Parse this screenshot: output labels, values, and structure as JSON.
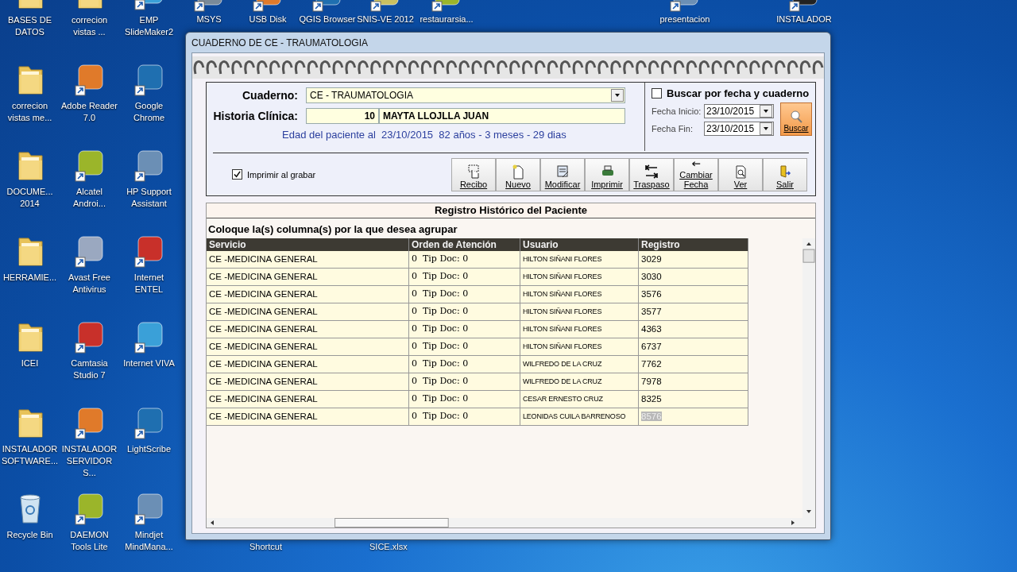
{
  "desktop": {
    "left_icons": [
      {
        "label": "BASES DE DATOS",
        "kind": "folder"
      },
      {
        "label": "correcion vistas ...",
        "kind": "folder"
      },
      {
        "label": "EMP SlideMaker2",
        "kind": "shortcut"
      },
      {
        "label": "correcion vistas me...",
        "kind": "folder"
      },
      {
        "label": "Adobe Reader 7.0",
        "kind": "shortcut"
      },
      {
        "label": "Google Chrome",
        "kind": "shortcut"
      },
      {
        "label": "DOCUME... 2014",
        "kind": "folder"
      },
      {
        "label": "Alcatel Androi...",
        "kind": "shortcut"
      },
      {
        "label": "HP Support Assistant",
        "kind": "shortcut"
      },
      {
        "label": "HERRAMIE...",
        "kind": "folder"
      },
      {
        "label": "Avast Free Antivirus",
        "kind": "shortcut"
      },
      {
        "label": "Internet ENTEL",
        "kind": "shortcut"
      },
      {
        "label": "ICEI",
        "kind": "folder"
      },
      {
        "label": "Camtasia Studio 7",
        "kind": "shortcut"
      },
      {
        "label": "Internet VIVA",
        "kind": "shortcut"
      },
      {
        "label": "INSTALADOR SOFTWARE...",
        "kind": "folder"
      },
      {
        "label": "INSTALADOR SERVIDOR S...",
        "kind": "shortcut"
      },
      {
        "label": "LightScribe",
        "kind": "shortcut"
      },
      {
        "label": "Recycle Bin",
        "kind": "bin"
      },
      {
        "label": "DAEMON Tools Lite",
        "kind": "shortcut"
      },
      {
        "label": "Mindjet MindMana...",
        "kind": "shortcut"
      }
    ],
    "top_icons": [
      {
        "label": "MSYS"
      },
      {
        "label": "USB Disk"
      },
      {
        "label": "QGIS Browser"
      },
      {
        "label": "SNIS-VE 2012"
      },
      {
        "label": "restaurarsia..."
      },
      {
        "label": "presentacion"
      },
      {
        "label": "INSTALADOR"
      }
    ],
    "bottom_labels": [
      "Shortcut",
      "SICE.xlsx"
    ]
  },
  "window": {
    "title": "CUADERNO DE CE - TRAUMATOLOGIA",
    "cuaderno": {
      "label": "Cuaderno:",
      "value": "CE - TRAUMATOLOGIA"
    },
    "historia": {
      "label": "Historia Clínica:",
      "number": "10",
      "name": "MAYTA LLOJLLA JUAN"
    },
    "age_line": "Edad del paciente al  23/10/2015  82 años - 3 meses - 29 dias",
    "search": {
      "label": "Buscar por fecha y cuaderno",
      "checked": false,
      "fecha_inicio": {
        "label": "Fecha Inicio:",
        "value": "23/10/2015"
      },
      "fecha_fin": {
        "label": "Fecha Fin:",
        "value": "23/10/2015"
      },
      "button": "Buscar"
    },
    "print_on_save": {
      "label": "Imprimir al grabar",
      "checked": true
    },
    "toolbar": [
      {
        "label": "Recibo"
      },
      {
        "label": "Nuevo"
      },
      {
        "label": "Modificar"
      },
      {
        "label": "Imprimir"
      },
      {
        "label": "Traspaso"
      },
      {
        "label": "Cambiar Fecha"
      },
      {
        "label": "Ver"
      },
      {
        "label": "Salir"
      }
    ],
    "history": {
      "title": "Registro Histórico del Paciente",
      "group_hint": "Coloque la(s) columna(s) por la que desea agrupar",
      "columns": [
        "Servicio",
        "Orden de Atención",
        "Usuario",
        "Registro"
      ],
      "rows": [
        {
          "servicio": "CE -MEDICINA GENERAL",
          "orden": "0  Tip Doc: 0",
          "usuario": "HILTON SIÑANI FLORES",
          "registro": "3029",
          "selected": false
        },
        {
          "servicio": "CE -MEDICINA GENERAL",
          "orden": "0  Tip Doc: 0",
          "usuario": "HILTON SIÑANI FLORES",
          "registro": "3030",
          "selected": false
        },
        {
          "servicio": "CE -MEDICINA GENERAL",
          "orden": "0  Tip Doc: 0",
          "usuario": "HILTON SIÑANI FLORES",
          "registro": "3576",
          "selected": false
        },
        {
          "servicio": "CE -MEDICINA GENERAL",
          "orden": "0  Tip Doc: 0",
          "usuario": "HILTON SIÑANI FLORES",
          "registro": "3577",
          "selected": false
        },
        {
          "servicio": "CE -MEDICINA GENERAL",
          "orden": "0  Tip Doc: 0",
          "usuario": "HILTON SIÑANI FLORES",
          "registro": "4363",
          "selected": false
        },
        {
          "servicio": "CE -MEDICINA GENERAL",
          "orden": "0  Tip Doc: 0",
          "usuario": "HILTON SIÑANI FLORES",
          "registro": "6737",
          "selected": false
        },
        {
          "servicio": "CE -MEDICINA GENERAL",
          "orden": "0  Tip Doc: 0",
          "usuario": "WILFREDO DE LA CRUZ",
          "registro": "7762",
          "selected": false
        },
        {
          "servicio": "CE -MEDICINA GENERAL",
          "orden": "0  Tip Doc: 0",
          "usuario": "WILFREDO DE LA CRUZ",
          "registro": "7978",
          "selected": false
        },
        {
          "servicio": "CE -MEDICINA GENERAL",
          "orden": "0  Tip Doc: 0",
          "usuario": "CESAR ERNESTO CRUZ",
          "registro": "8325",
          "selected": false
        },
        {
          "servicio": "CE -MEDICINA GENERAL",
          "orden": "0  Tip Doc: 0",
          "usuario": "LEONIDAS CUILA BARRENOSO",
          "registro": "8576",
          "selected": true
        }
      ]
    }
  }
}
